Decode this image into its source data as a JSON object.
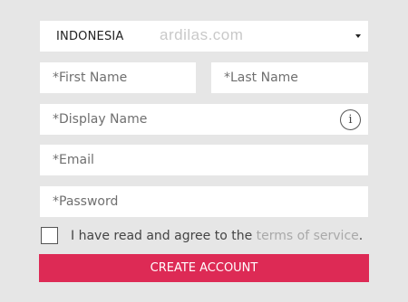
{
  "country": {
    "value": "INDONESIA",
    "watermark": "ardilas.com"
  },
  "fields": {
    "first_name": "*First Name",
    "last_name": "*Last Name",
    "display_name": "*Display Name",
    "email": "*Email",
    "password": "*Password"
  },
  "info_icon": {
    "glyph": "i",
    "icon": "info-icon"
  },
  "agree": {
    "text": "I have read and agree to the ",
    "link": "terms of service",
    "suffix": "."
  },
  "submit_label": "CREATE ACCOUNT",
  "colors": {
    "accent": "#dd2a55",
    "background": "#e6e6e6"
  }
}
